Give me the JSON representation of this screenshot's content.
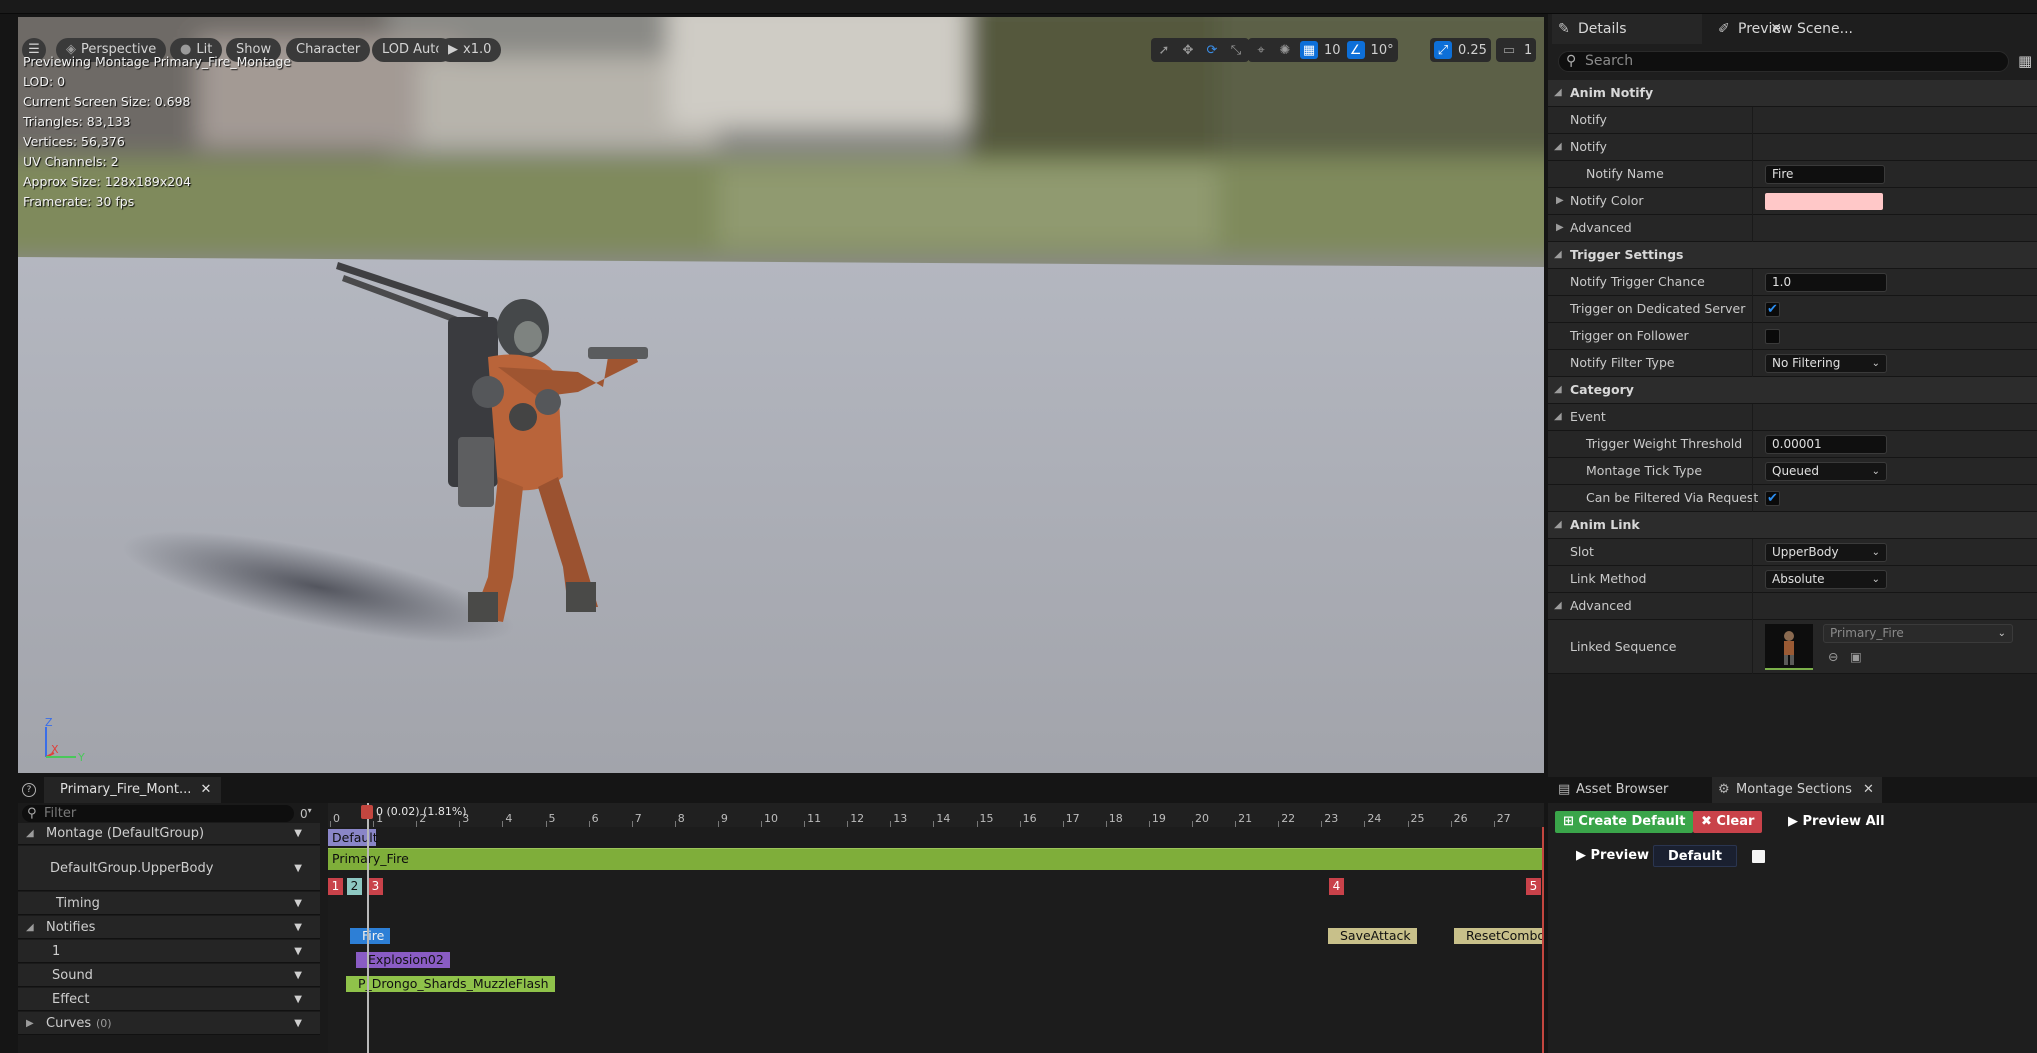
{
  "viewport": {
    "menu_icon": "hamburger-icon",
    "perspective_label": "Perspective",
    "lit_label": "Lit",
    "show_label": "Show",
    "character_label": "Character",
    "lod_label": "LOD Auto",
    "play_speed_label": "x1.0",
    "grid_size": "10",
    "rotation_snap": "10°",
    "scale_snap": "0.25",
    "camera_speed": "1",
    "stats": {
      "line1": "Previewing Montage Primary_Fire_Montage",
      "line2": "LOD: 0",
      "line3": "Current Screen Size: 0.698",
      "line4": "Triangles: 83,133",
      "line5": "Vertices: 56,376",
      "line6": "UV Channels: 2",
      "line7": "Approx Size: 128x189x204",
      "line8": "Framerate: 30 fps"
    },
    "axis_z": "Z",
    "axis_x": "X",
    "axis_y": "Y"
  },
  "details": {
    "tab_details": "Details",
    "tab_preview": "Preview Scene...",
    "search_placeholder": "Search",
    "rows": {
      "anim_notify": "Anim Notify",
      "notify_a": "Notify",
      "notify_b": "Notify",
      "notify_name_label": "Notify Name",
      "notify_name_value": "Fire",
      "notify_color_label": "Notify Color",
      "notify_color_value": "#ffc8c8",
      "advanced_a": "Advanced",
      "trigger_settings": "Trigger Settings",
      "trigger_chance_label": "Notify Trigger Chance",
      "trigger_chance_value": "1.0",
      "dedicated_server_label": "Trigger on Dedicated Server",
      "follower_label": "Trigger on Follower",
      "filter_type_label": "Notify Filter Type",
      "filter_type_value": "No Filtering",
      "category": "Category",
      "event": "Event",
      "weight_threshold_label": "Trigger Weight Threshold",
      "weight_threshold_value": "0.00001",
      "tick_type_label": "Montage Tick Type",
      "tick_type_value": "Queued",
      "filtered_label": "Can be Filtered Via Request",
      "anim_link": "Anim Link",
      "slot_label": "Slot",
      "slot_value": "UpperBody",
      "link_method_label": "Link Method",
      "link_method_value": "Absolute",
      "advanced_b": "Advanced",
      "linked_sequence_label": "Linked Sequence",
      "linked_sequence_value": "Primary_Fire"
    }
  },
  "timeline": {
    "tab_label": "Primary_Fire_Mont...",
    "filter_placeholder": "Filter",
    "frame_zero": "0",
    "playhead_label": "0 (0.02) (1.81%)",
    "ticks": [
      "0",
      "1",
      "2",
      "3",
      "4",
      "5",
      "6",
      "7",
      "8",
      "9",
      "10",
      "11",
      "12",
      "13",
      "14",
      "15",
      "16",
      "17",
      "18",
      "19",
      "20",
      "21",
      "22",
      "23",
      "24",
      "25",
      "26",
      "27"
    ],
    "rows": {
      "montage": "Montage (DefaultGroup)",
      "slot": "DefaultGroup.UpperBody",
      "timing": "Timing",
      "notifies": "Notifies",
      "track1": "1",
      "sound": "Sound",
      "effect": "Effect",
      "curves": "Curves",
      "curves_count": "(0)"
    },
    "section_default": "Default",
    "segment_primary": "Primary_Fire",
    "timing_markers": [
      "1",
      "2",
      "3",
      "4",
      "5"
    ],
    "notifies": {
      "fire": "Fire",
      "save_attack": "SaveAttack",
      "reset_combo": "ResetCombo",
      "explosion": "Explosion02",
      "muzzle": "P_Drongo_Shards_MuzzleFlash"
    }
  },
  "sections": {
    "tab_asset_browser": "Asset Browser",
    "tab_montage_sections": "Montage Sections",
    "create_default": "Create Default",
    "clear": "Clear",
    "preview_all": "Preview All",
    "preview": "Preview",
    "default_section": "Default"
  },
  "colors": {
    "accent_blue": "#0d6fd8",
    "segment_green": "#7fae3a",
    "section_purple": "#8a86c8",
    "timing_red": "#c9424a",
    "notify_tan": "#c8c08a",
    "sound_purple": "#8a5cc4",
    "effect_green": "#8fc24a",
    "create_green": "#3aa54a",
    "clear_red": "#c9424a"
  }
}
